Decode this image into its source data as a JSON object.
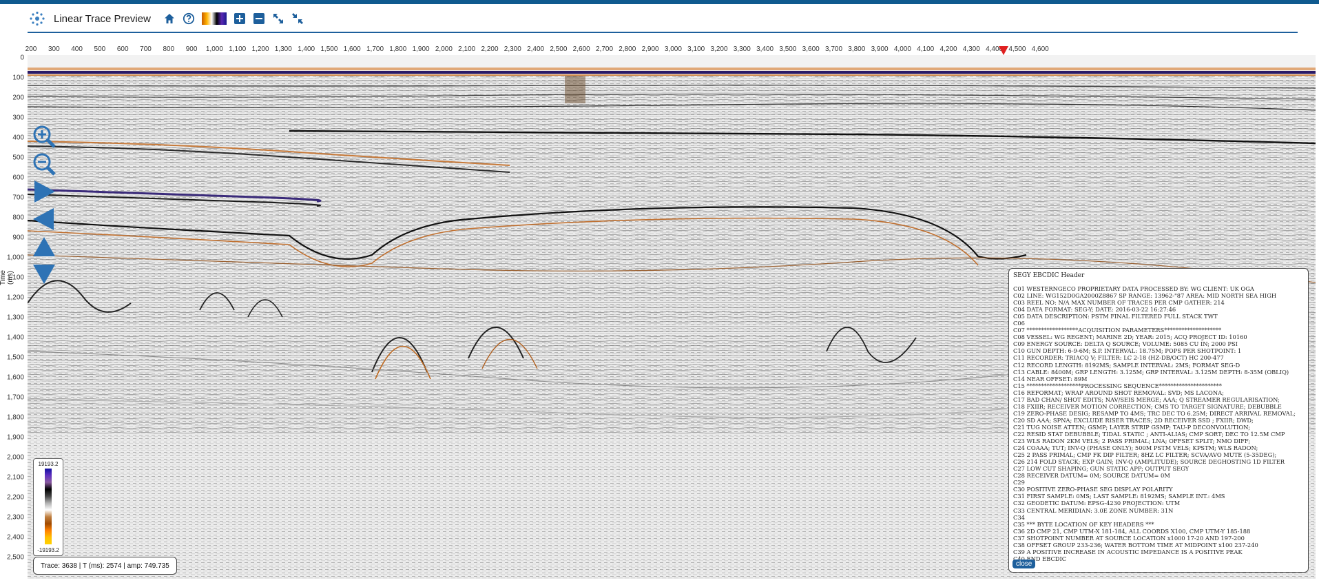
{
  "app": {
    "title": "Linear Trace Preview",
    "toolbar": {
      "icons": [
        "logo-icon",
        "home-icon",
        "help-icon",
        "colorbar-thumbnail-icon",
        "zoom-in-icon",
        "zoom-out-icon",
        "expand-icon",
        "collapse-icon"
      ]
    }
  },
  "axes": {
    "x_ticks": [
      "200",
      "300",
      "400",
      "500",
      "600",
      "700",
      "800",
      "900",
      "1,000",
      "1,100",
      "1,200",
      "1,300",
      "1,400",
      "1,500",
      "1,600",
      "1,700",
      "1,800",
      "1,900",
      "2,000",
      "2,100",
      "2,200",
      "2,300",
      "2,400",
      "2,500",
      "2,600",
      "2,700",
      "2,800",
      "2,900",
      "3,000",
      "3,100",
      "3,200",
      "3,300",
      "3,400",
      "3,500",
      "3,600",
      "3,700",
      "3,800",
      "3,900",
      "4,000",
      "4,100",
      "4,200",
      "4,300",
      "4,400",
      "4,500",
      "4,600"
    ],
    "y_ticks": [
      "0",
      "100",
      "200",
      "300",
      "400",
      "500",
      "600",
      "700",
      "800",
      "900",
      "1,000",
      "1,100",
      "1,200",
      "1,300",
      "1,400",
      "1,500",
      "1,600",
      "1,700",
      "1,800",
      "1,900",
      "2,000",
      "2,100",
      "2,200",
      "2,300",
      "2,400",
      "2,500"
    ],
    "y_label": "Time (ms)"
  },
  "colorbar": {
    "max_label": "19193.2",
    "min_label": "-19193.2"
  },
  "status": {
    "text": "Trace: 3638 | T (ms): 2574 | amp: 749.735"
  },
  "ebcdic": {
    "title": "SEGY EBCDIC Header",
    "close_label": "close",
    "lines": [
      "C01 WESTERNGECO PROPRIETARY DATA PROCESSED BY: WG CLIENT: UK OGA",
      "C02 LINE: WG152D0GA2000Z8867 SP RANGE: 13962-\"87 AREA: MID NORTH SEA HIGH",
      "C03 REEL NO: N/A MAX NUMBER OF TRACES PER CMP GATHER: 214",
      "C04 DATA FORMAT: SEG-Y; DATE: 2016-03-22 16:27:46",
      "C05 DATA DESCRIPTION: PSTM FINAL FILTERED FULL STACK TWT",
      "C06",
      "C07 ******************ACQUISITION PARAMETERS********************",
      "C08 VESSEL: WG REGENT; MARINE 2D; YEAR: 2015; ACQ PROJECT ID: 10160",
      "C09 ENERGY SOURCE: DELTA Q SOURCE; VOLUME: 5085 CU IN; 2000 PSI",
      "C10 GUN DEPTH: 6-9-6M; S.P. INTERVAL: 18.75M; POPS PER SHOTPOINT: 1",
      "C11 RECORDER: TRIACQ V; FILTER: LC 2-18 (HZ-DB/OCT) HC 200-477",
      "C12 RECORD LENGTH: 8192MS; SAMPLE INTERVAL: 2MS; FORMAT SEG-D",
      "C13 CABLE: 8400M; GRP LENGTH: 3.125M; GRP INTERVAL: 3.125M DEPTH: 8-35M (OBLIQ)",
      "C14 NEAR OFFSET: 89M",
      "C15 *******************PROCESSING SEQUENCE**********************",
      "C16 REFORMAT; WRAP AROUND SHOT REMOVAL: SVD; MS LACONA;",
      "C17 BAD CHAN/ SHOT EDITS; NAV/SEIS MERGE; AAA; Q STREAMER REGULARISATION;",
      "C18 FXIIR; RECEIVER MOTION CORRECTION; CMS TO TARGET SIGNATURE; DEBUBBLE",
      "C19 ZERO-PHASE DESIG; RESAMP TO 4MS; TRC DEC TO 6.25M; DIRECT ARRIVAL REMOVAL;",
      "C20 SD AAA; SPNA; EXCLUDE RISER TRACES; 2D RECEIVER SSD ; FXIIR; DWD;",
      "C21 TUG NOISE ATTEN; GSMP; LAYER STRIP GSMP; TAU-P DECONVOLUTION;",
      "C22 RESID STAT DEBUBBLE; TIDAL STATIC ; ANTI-ALIAS; CMP SORT; DEC TO 12.5M CMP",
      "C23 WLS RADON 2KM VELS; 2 PASS PRIMAL; LNA; OFFSET SPLIT; NMO DIFF;",
      "C24 COAAA; TUT; INV-Q (PHASE ONLY); 500M PSTM VELS; KPSTM; WLS RADON;",
      "C25 2 PASS PRIMAL; CMP FK DIP FILTER; 8HZ LC FILTER; SCVA/AVO MUTE (5-35DEG);",
      "C26 214 FOLD STACK; EXP GAIN; INV-Q (AMPLITUDE); SOURCE DEGHOSTING 1D FILTER",
      "C27 LOW CUT SHAPING; GUN STATIC APP; OUTPUT SEGY",
      "C28 RECEIVER DATUM= 0M; SOURCE DATUM= 0M",
      "C29",
      "C30 POSITIVE ZERO-PHASE SEG DISPLAY POLARITY",
      "C31 FIRST SAMPLE: 0MS; LAST SAMPLE: 8192MS; SAMPLE INT.: 4MS",
      "C32 GEODETIC DATUM: EPSG-4230 PROJECTION: UTM",
      "C33 CENTRAL MERIDIAN: 3.0E ZONE NUMBER: 31N",
      "C34",
      "C35 *** BYTE LOCATION OF KEY HEADERS ***",
      "C36 2D CMP 21, CMP UTM-X 181-184, ALL COORDS X100, CMP UTM-Y 185-188",
      "C37 SHOTPOINT NUMBER AT SOURCE LOCATION x1000 17-20 AND 197-200",
      "C38 OFFSET GROUP 233-236; WATER BOTTOM TIME AT MIDPOINT x100 237-240",
      "C39 A POSITIVE INCREASE IN ACOUSTIC IMPEDANCE IS A POSITIVE PEAK",
      "C40 END EBCDIC"
    ]
  }
}
